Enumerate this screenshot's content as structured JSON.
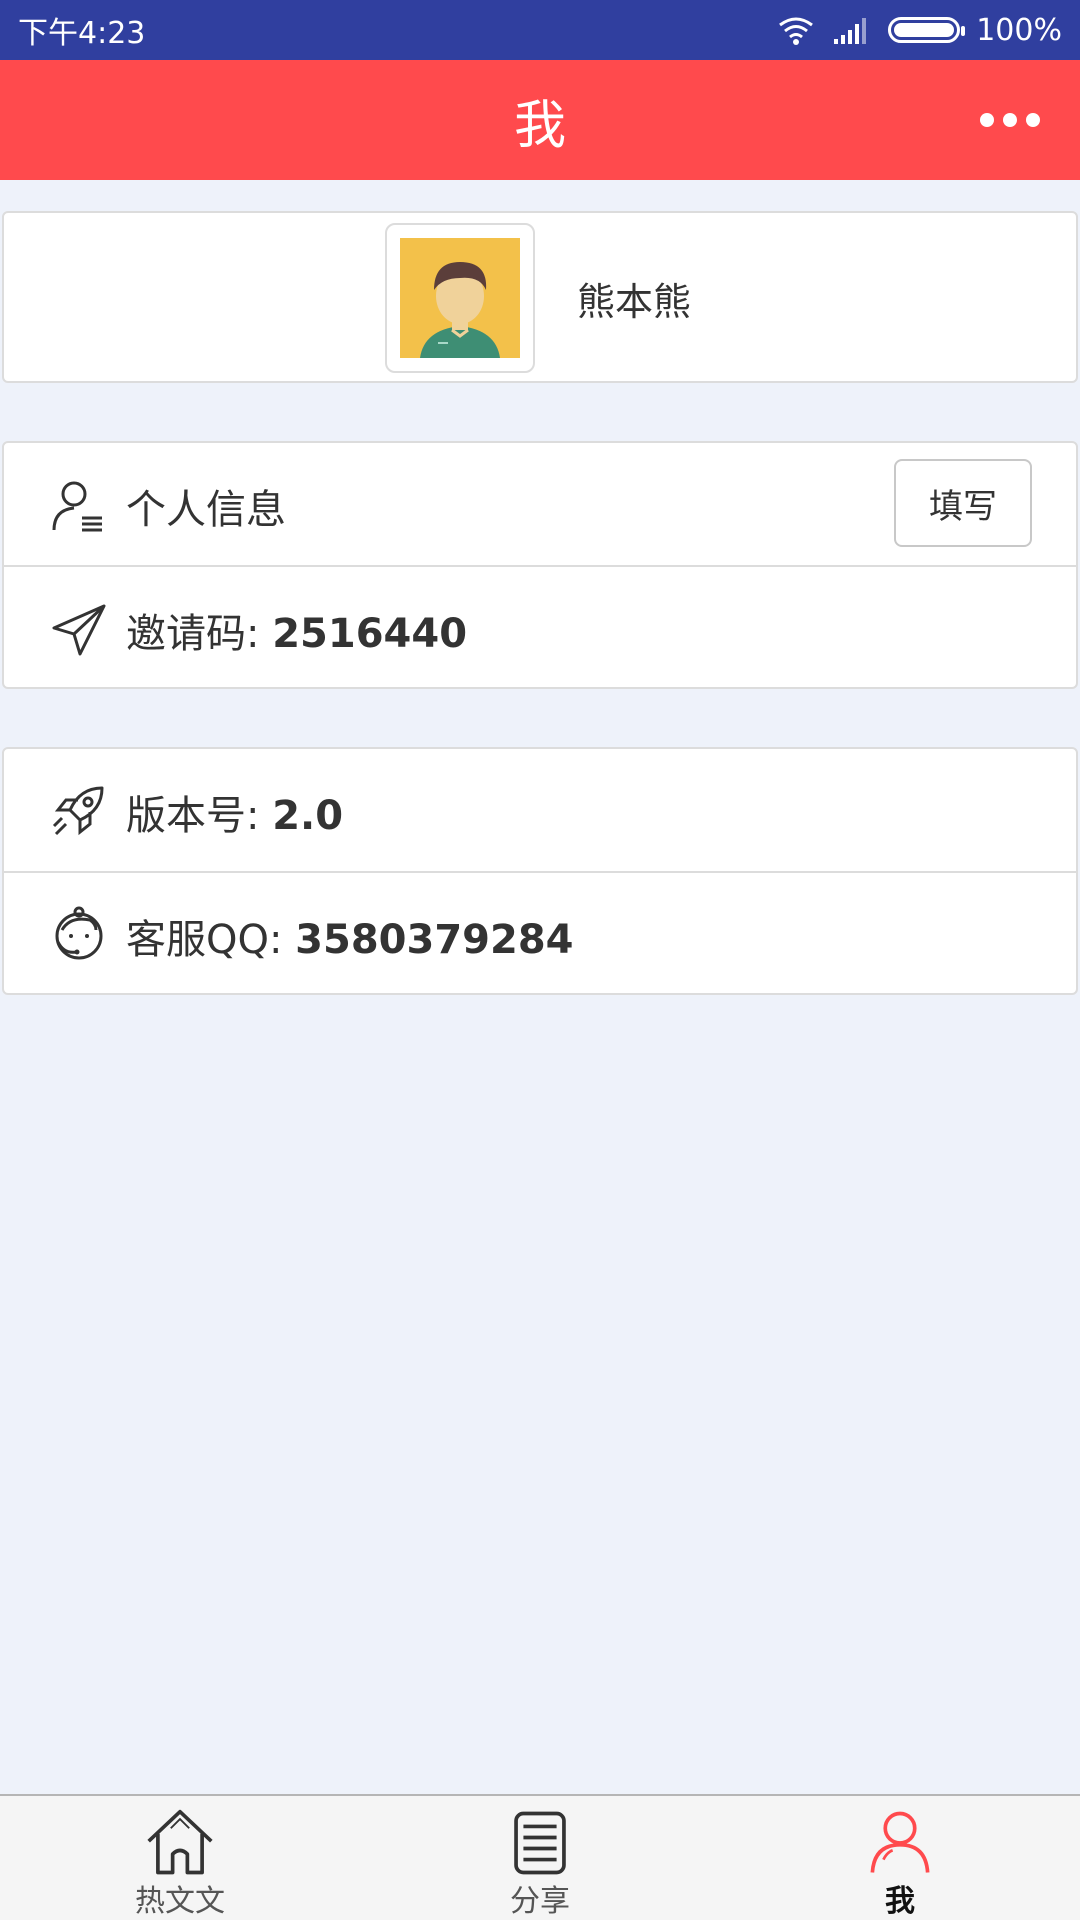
{
  "status_bar": {
    "time": "下午4:23",
    "battery": "100%"
  },
  "header": {
    "title": "我"
  },
  "profile": {
    "name": "熊本熊"
  },
  "info_section": {
    "personal_info_label": "个人信息",
    "fill_button_label": "填写",
    "invite_label": "邀请码:",
    "invite_code": "2516440"
  },
  "about_section": {
    "version_label": "版本号:",
    "version_value": "2.0",
    "support_label": "客服QQ:",
    "support_value": "3580379284"
  },
  "tabs": [
    {
      "label": "热文文",
      "icon": "home-icon",
      "active": false
    },
    {
      "label": "分享",
      "icon": "list-icon",
      "active": false
    },
    {
      "label": "我",
      "icon": "user-icon",
      "active": true
    }
  ],
  "colors": {
    "status_bar": "#303f9f",
    "title_bar": "#ff4a4d",
    "active_tab": "#ff4a4d",
    "background": "#eef2fa"
  }
}
